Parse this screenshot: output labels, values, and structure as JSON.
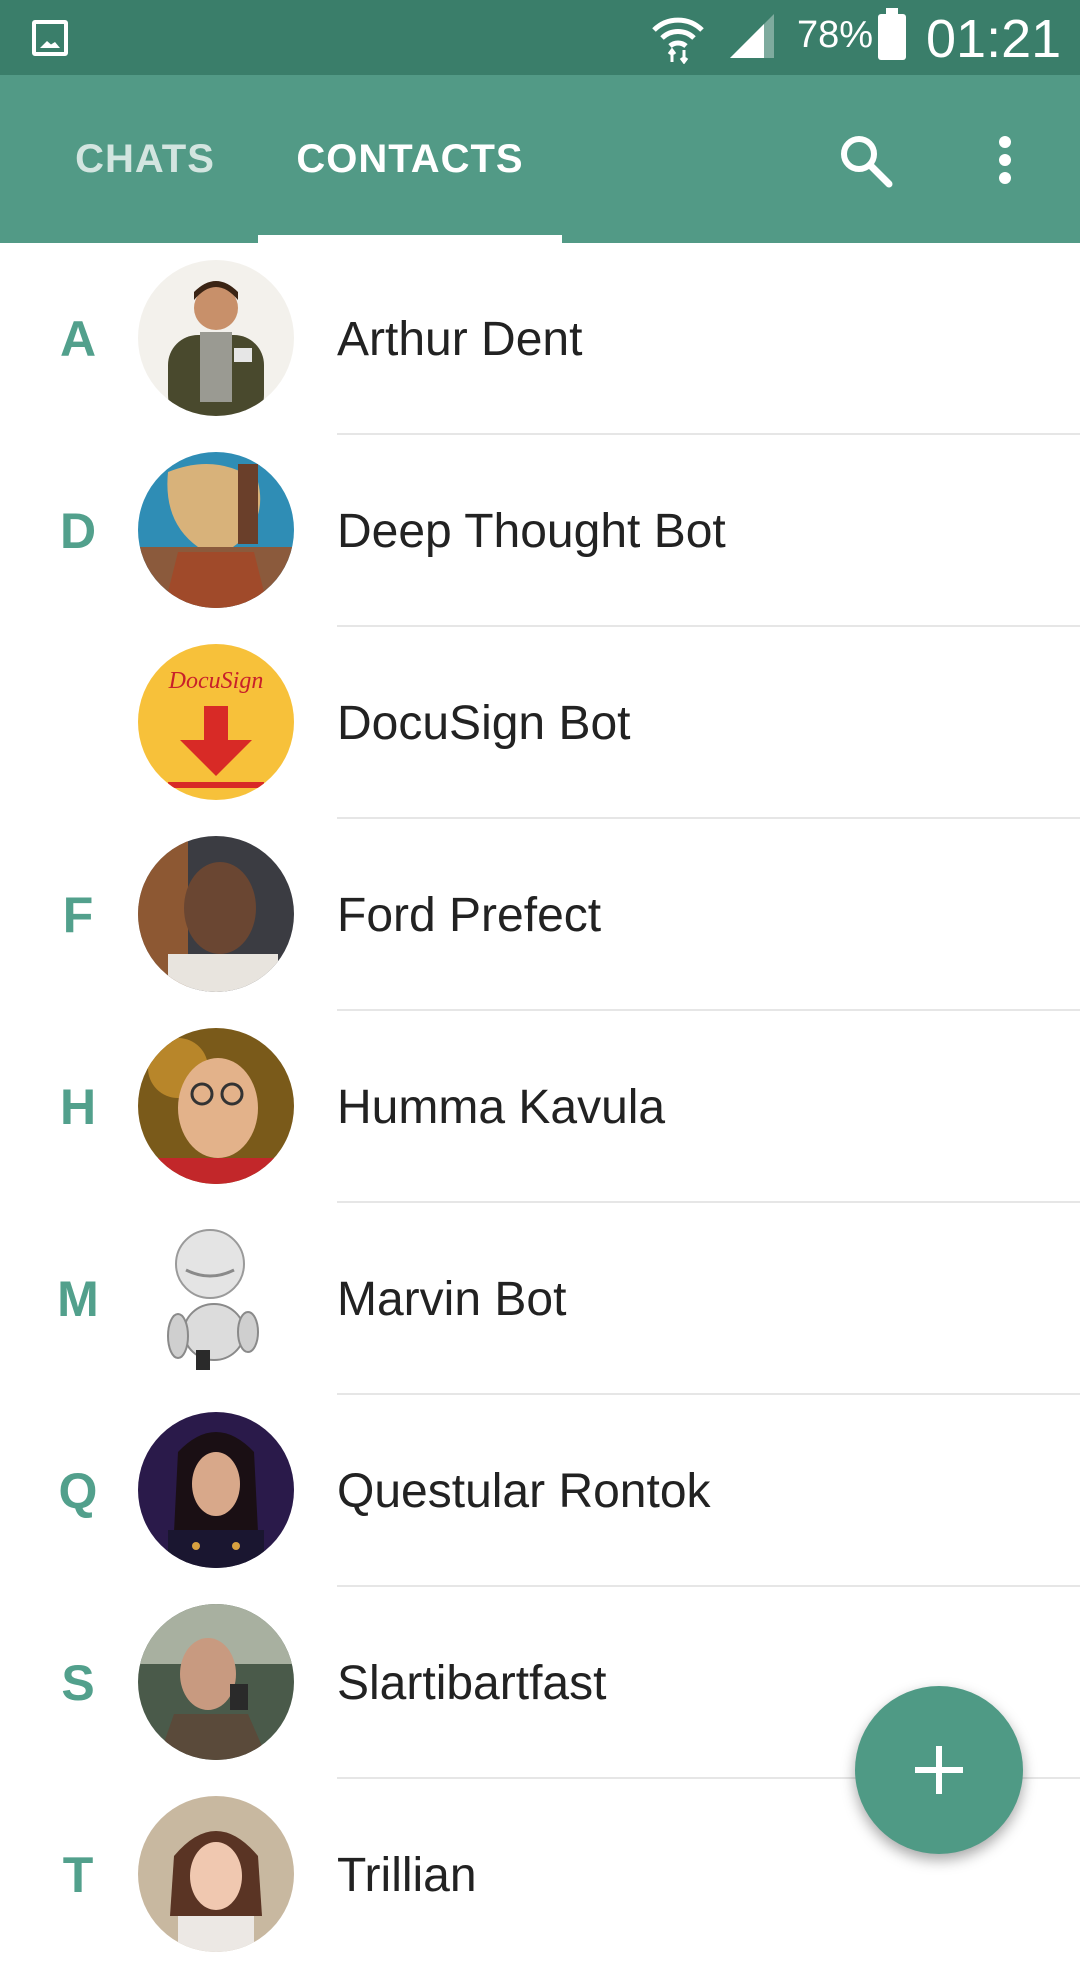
{
  "status_bar": {
    "battery": "78%",
    "time": "01:21"
  },
  "tabs": [
    {
      "label": "CHATS"
    },
    {
      "label": "CONTACTS"
    }
  ],
  "active_tab": "CONTACTS",
  "colors": {
    "status_bar": "#3a7e6a",
    "app_bar": "#529a86",
    "accent": "#52a08c",
    "fab": "#4f9a85"
  },
  "contacts": [
    {
      "letter": "A",
      "name": "Arthur Dent"
    },
    {
      "letter": "D",
      "name": "Deep Thought Bot"
    },
    {
      "letter": "",
      "name": "DocuSign Bot"
    },
    {
      "letter": "F",
      "name": "Ford Prefect"
    },
    {
      "letter": "H",
      "name": "Humma Kavula"
    },
    {
      "letter": "M",
      "name": "Marvin Bot"
    },
    {
      "letter": "Q",
      "name": "Questular Rontok"
    },
    {
      "letter": "S",
      "name": "Slartibartfast"
    },
    {
      "letter": "T",
      "name": "Trillian"
    }
  ],
  "icons": {
    "search": "search-icon",
    "more": "more-vert-icon",
    "fab": "add-icon"
  }
}
